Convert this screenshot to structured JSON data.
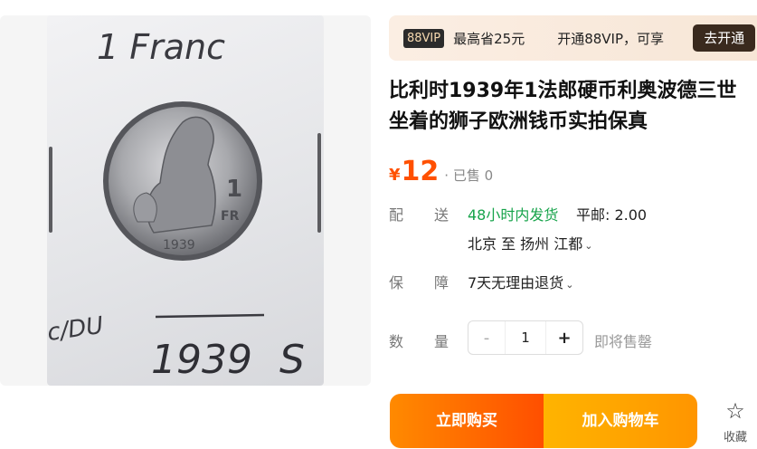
{
  "gallery": {
    "photo_caption_top": "1 Franc",
    "photo_caption_year": "1939",
    "photo_caption_grade": "S",
    "photo_caption_left": "c/DU",
    "coin_denomination": "1",
    "coin_unit": "FR",
    "coin_year": "1939"
  },
  "vip": {
    "badge": "88VIP",
    "save_text": "最高省25元",
    "promo_text": "开通88VIP，可享",
    "open_button": "去开通"
  },
  "product": {
    "title_line1": "比利时1939年1法郎硬币利奥波德三世",
    "title_line2": "坐着的狮子欧洲钱币实拍保真",
    "currency_symbol": "¥",
    "price": "12",
    "sold": "· 已售 0"
  },
  "shipping": {
    "label": "配送",
    "fast_text": "48小时内发货",
    "fee_text": "平邮: 2.00",
    "route_text": "北京  至  扬州 江都"
  },
  "guarantee": {
    "label": "保障",
    "text": "7天无理由退货"
  },
  "quantity": {
    "label": "数量",
    "minus": "-",
    "value": "1",
    "plus": "+",
    "note": "即将售罄"
  },
  "actions": {
    "buy_now": "立即购买",
    "add_to_cart": "加入购物车",
    "favorite_icon": "star-outline-icon",
    "favorite_label": "收藏"
  },
  "colors": {
    "price": "#ff5000",
    "fast_shipping": "#16a34a",
    "buy_gradient": [
      "#ff8a00",
      "#ff4f00"
    ],
    "cart_gradient": [
      "#ffb400",
      "#ff9500"
    ]
  }
}
